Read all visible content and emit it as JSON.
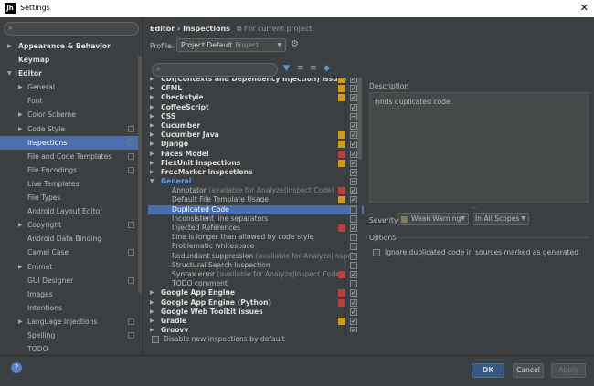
{
  "window": {
    "title": "Settings",
    "app_icon": "Jh"
  },
  "left": {
    "search_placeholder": "",
    "items": [
      {
        "label": "Appearance & Behavior",
        "level": 0,
        "arrow": "right",
        "bold": true
      },
      {
        "label": "Keymap",
        "level": 0,
        "arrow": "",
        "bold": true
      },
      {
        "label": "Editor",
        "level": 0,
        "arrow": "down",
        "bold": true
      },
      {
        "label": "General",
        "level": 1,
        "arrow": "right"
      },
      {
        "label": "Font",
        "level": 1,
        "arrow": ""
      },
      {
        "label": "Color Scheme",
        "level": 1,
        "arrow": "right"
      },
      {
        "label": "Code Style",
        "level": 1,
        "arrow": "right",
        "proj": true
      },
      {
        "label": "Inspections",
        "level": 1,
        "arrow": "",
        "proj": true,
        "selected": true
      },
      {
        "label": "File and Code Templates",
        "level": 1,
        "arrow": "",
        "proj": true
      },
      {
        "label": "File Encodings",
        "level": 1,
        "arrow": "",
        "proj": true
      },
      {
        "label": "Live Templates",
        "level": 1,
        "arrow": ""
      },
      {
        "label": "File Types",
        "level": 1,
        "arrow": ""
      },
      {
        "label": "Android Layout Editor",
        "level": 1,
        "arrow": ""
      },
      {
        "label": "Copyright",
        "level": 1,
        "arrow": "right",
        "proj": true
      },
      {
        "label": "Android Data Binding",
        "level": 1,
        "arrow": ""
      },
      {
        "label": "Camel Case",
        "level": 1,
        "arrow": "",
        "proj": true
      },
      {
        "label": "Emmet",
        "level": 1,
        "arrow": "right"
      },
      {
        "label": "GUI Designer",
        "level": 1,
        "arrow": "",
        "proj": true
      },
      {
        "label": "Images",
        "level": 1,
        "arrow": ""
      },
      {
        "label": "Intentions",
        "level": 1,
        "arrow": ""
      },
      {
        "label": "Language Injections",
        "level": 1,
        "arrow": "right",
        "proj": true
      },
      {
        "label": "Spelling",
        "level": 1,
        "arrow": "",
        "proj": true
      },
      {
        "label": "TODO",
        "level": 1,
        "arrow": ""
      }
    ]
  },
  "header": {
    "breadcrumb_parent": "Editor",
    "breadcrumb_sep": "›",
    "breadcrumb_current": "Inspections",
    "for_current_project": "For current project",
    "profile_label": "Profile:",
    "profile_value": "Project Default",
    "profile_sub": "Project"
  },
  "inspections": [
    {
      "label": "CDI(Contexts and Dependency Injection) issues",
      "level": 0,
      "arrow": "right",
      "bold": true,
      "sev": "#d19a1a",
      "check": "✓"
    },
    {
      "label": "CFML",
      "level": 0,
      "arrow": "right",
      "bold": true,
      "sev": "#d19a1a",
      "check": "✓"
    },
    {
      "label": "Checkstyle",
      "level": 0,
      "arrow": "right",
      "bold": true,
      "sev": "#d19a1a",
      "check": "✓"
    },
    {
      "label": "CoffeeScript",
      "level": 0,
      "arrow": "right",
      "bold": true,
      "sev": "",
      "check": "✓"
    },
    {
      "label": "CSS",
      "level": 0,
      "arrow": "right",
      "bold": true,
      "sev": "",
      "check": "−"
    },
    {
      "label": "Cucumber",
      "level": 0,
      "arrow": "right",
      "bold": true,
      "sev": "",
      "check": "✓"
    },
    {
      "label": "Cucumber Java",
      "level": 0,
      "arrow": "right",
      "bold": true,
      "sev": "#d19a1a",
      "check": "✓"
    },
    {
      "label": "Django",
      "level": 0,
      "arrow": "right",
      "bold": true,
      "sev": "#d19a1a",
      "check": "✓"
    },
    {
      "label": "Faces Model",
      "level": 0,
      "arrow": "right",
      "bold": true,
      "sev": "#bc3f3c",
      "check": "✓"
    },
    {
      "label": "FlexUnit inspections",
      "level": 0,
      "arrow": "right",
      "bold": true,
      "sev": "#d19a1a",
      "check": "✓"
    },
    {
      "label": "FreeMarker inspections",
      "level": 0,
      "arrow": "right",
      "bold": true,
      "sev": "",
      "check": "✓"
    },
    {
      "label": "General",
      "level": 0,
      "arrow": "down",
      "group": true,
      "sev": "",
      "check": "−"
    },
    {
      "label": "Annotator",
      "note": " (available for Analyze|Inspect Code)",
      "level": 1,
      "sev": "#bc3f3c",
      "check": "✓"
    },
    {
      "label": "Default File Template Usage",
      "level": 1,
      "sev": "#d19a1a",
      "check": "✓"
    },
    {
      "label": "Duplicated Code",
      "level": 1,
      "sev": "",
      "check": "",
      "selected": true
    },
    {
      "label": "Inconsistent line separators",
      "level": 1,
      "sev": "",
      "check": ""
    },
    {
      "label": "Injected References",
      "level": 1,
      "sev": "#bc3f3c",
      "check": "✓"
    },
    {
      "label": "Line is longer than allowed by code style",
      "level": 1,
      "sev": "",
      "check": ""
    },
    {
      "label": "Problematic whitespace",
      "level": 1,
      "sev": "",
      "check": ""
    },
    {
      "label": "Redundant suppression",
      "note": " (available for Analyze|Inspe",
      "level": 1,
      "sev": "",
      "check": ""
    },
    {
      "label": "Structural Search Inspection",
      "level": 1,
      "sev": "",
      "check": ""
    },
    {
      "label": "Syntax error",
      "note": " (available for Analyze|Inspect Code)",
      "level": 1,
      "sev": "#bc3f3c",
      "check": "✓"
    },
    {
      "label": "TODO comment",
      "level": 1,
      "sev": "",
      "check": ""
    },
    {
      "label": "Google App Engine",
      "level": 0,
      "arrow": "right",
      "bold": true,
      "sev": "#bc3f3c",
      "check": "✓"
    },
    {
      "label": "Google App Engine (Python)",
      "level": 0,
      "arrow": "right",
      "bold": true,
      "sev": "#bc3f3c",
      "check": "✓"
    },
    {
      "label": "Google Web Toolkit issues",
      "level": 0,
      "arrow": "right",
      "bold": true,
      "sev": "",
      "check": "✓"
    },
    {
      "label": "Gradle",
      "level": 0,
      "arrow": "right",
      "bold": true,
      "sev": "#d19a1a",
      "check": "✓"
    },
    {
      "label": "Groovy",
      "level": 0,
      "arrow": "right",
      "bold": true,
      "sev": "",
      "check": "✓"
    }
  ],
  "disable_new": "Disable new inspections by default",
  "description": {
    "label": "Description",
    "text": "Finds duplicated code",
    "dots": "..."
  },
  "severity": {
    "label": "Severity:",
    "value": "Weak Warning",
    "scope": "In All Scopes"
  },
  "options": {
    "label": "Options",
    "ignore_generated": "Ignore duplicated code in sources marked as generated"
  },
  "buttons": {
    "ok": "OK",
    "cancel": "Cancel",
    "apply": "Apply",
    "help": "?"
  },
  "colors": {
    "accent": "#4b6eaf",
    "group": "#589df6",
    "error": "#bc3f3c",
    "warning": "#d19a1a"
  }
}
